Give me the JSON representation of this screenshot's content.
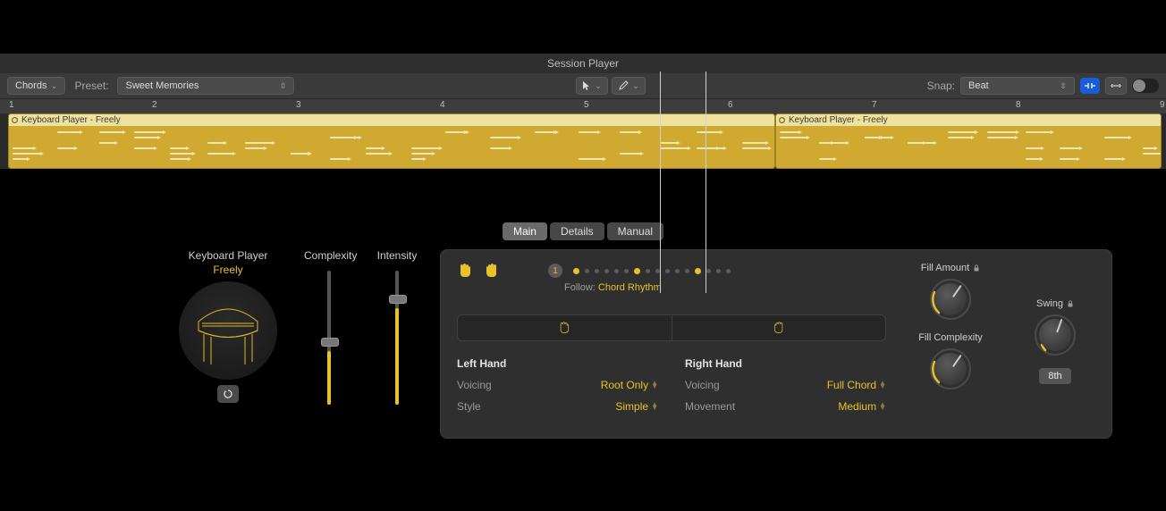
{
  "header": {
    "title": "Session Player"
  },
  "toolbar": {
    "chords_label": "Chords",
    "preset_label": "Preset:",
    "preset_value": "Sweet Memories",
    "snap_label": "Snap:",
    "snap_value": "Beat"
  },
  "ruler": {
    "marks": [
      "1",
      "2",
      "3",
      "4",
      "5",
      "6",
      "7",
      "8",
      "9"
    ]
  },
  "regions": [
    {
      "name": "Keyboard Player - Freely"
    },
    {
      "name": "Keyboard Player - Freely"
    }
  ],
  "tabs": {
    "main": "Main",
    "details": "Details",
    "manual": "Manual"
  },
  "player": {
    "title": "Keyboard Player",
    "name": "Freely",
    "complexity_label": "Complexity",
    "intensity_label": "Intensity"
  },
  "main": {
    "pattern_number": "1",
    "follow_label": "Follow:",
    "follow_value": "Chord Rhythm",
    "left": {
      "title": "Left Hand",
      "voicing_label": "Voicing",
      "voicing_value": "Root Only",
      "style_label": "Style",
      "style_value": "Simple"
    },
    "right": {
      "title": "Right Hand",
      "voicing_label": "Voicing",
      "voicing_value": "Full Chord",
      "movement_label": "Movement",
      "movement_value": "Medium"
    },
    "fill_amount_label": "Fill Amount",
    "fill_complexity_label": "Fill Complexity",
    "swing_label": "Swing",
    "swing_value": "8th"
  }
}
